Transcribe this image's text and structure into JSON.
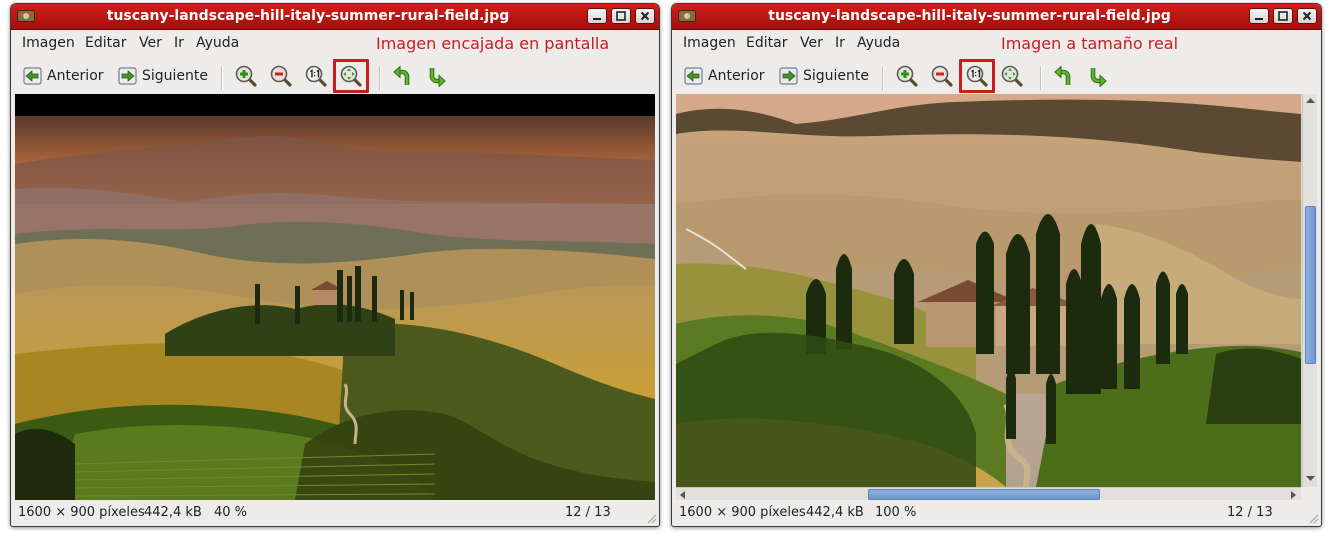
{
  "window_left": {
    "title": "tuscany-landscape-hill-italy-summer-rural-field.jpg",
    "menu": [
      "Imagen",
      "Editar",
      "Ver",
      "Ir",
      "Ayuda"
    ],
    "annotation": "Imagen encajada en pantalla",
    "toolbar": {
      "prev_label": "Anterior",
      "next_label": "Siguiente"
    },
    "status": {
      "dimensions": "1600 × 900 píxeles",
      "size": "442,4 kB",
      "zoom": "40 %",
      "position": "12 / 13"
    },
    "active_tool": "best-fit"
  },
  "window_right": {
    "title": "tuscany-landscape-hill-italy-summer-rural-field.jpg",
    "menu": [
      "Imagen",
      "Editar",
      "Ver",
      "Ir",
      "Ayuda"
    ],
    "annotation": "Imagen a tamaño real",
    "toolbar": {
      "prev_label": "Anterior",
      "next_label": "Siguiente"
    },
    "status": {
      "dimensions": "1600 × 900 píxeles",
      "size": "442,4 kB",
      "zoom": "100 %",
      "position": "12 / 13"
    },
    "active_tool": "normal-size",
    "scroll": {
      "vertical_fraction": 0.4,
      "horizontal_fraction": 0.35
    }
  },
  "colors": {
    "titlebar": "#b9140f",
    "annotation": "#c71e1c",
    "highlight_box": "#c71e1c",
    "scroll_thumb": "#7ea3d6"
  },
  "icons": [
    "image-app-icon",
    "back-icon",
    "forward-icon",
    "zoom-in-icon",
    "zoom-out-icon",
    "normal-size-icon",
    "best-fit-icon",
    "rotate-left-icon",
    "rotate-right-icon"
  ]
}
